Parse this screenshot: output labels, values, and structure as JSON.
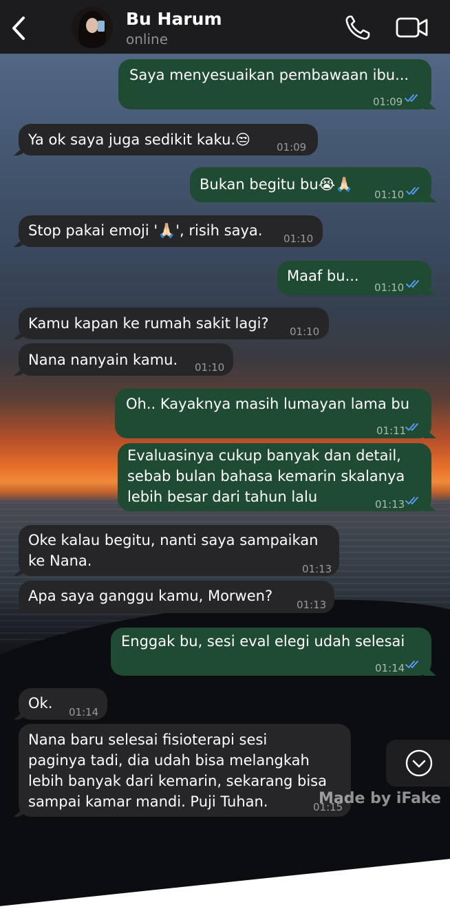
{
  "header": {
    "contact_name": "Bu Harum",
    "status": "online"
  },
  "messages": [
    {
      "dir": "out",
      "lines": [
        "Saya menyesuaikan pembawaan ibu..."
      ],
      "time": "01:09",
      "read": true
    },
    {
      "dir": "in",
      "lines": [
        "Ya ok saya juga sedikit kaku.😒"
      ],
      "time": "01:09"
    },
    {
      "dir": "out",
      "lines": [
        "Bukan begitu bu😭🙏🏻"
      ],
      "time": "01:10",
      "read": true
    },
    {
      "dir": "in",
      "lines": [
        "Stop pakai emoji '🙏🏻', risih saya."
      ],
      "time": "01:10"
    },
    {
      "dir": "out",
      "lines": [
        "Maaf bu..."
      ],
      "time": "01:10",
      "read": true
    },
    {
      "dir": "in",
      "lines": [
        "Kamu kapan ke rumah sakit lagi?"
      ],
      "time": "01:10"
    },
    {
      "dir": "in",
      "lines": [
        "Nana nanyain kamu."
      ],
      "time": "01:10"
    },
    {
      "dir": "out",
      "lines": [
        "Oh.. Kayaknya masih lumayan lama bu"
      ],
      "time": "01:11",
      "read": true
    },
    {
      "dir": "out",
      "lines": [
        "Evaluasinya cukup banyak dan detail,",
        "sebab bulan bahasa kemarin skalanya",
        "lebih besar dari tahun lalu"
      ],
      "time": "01:13",
      "read": true
    },
    {
      "dir": "in",
      "lines": [
        "Oke kalau begitu, nanti saya sampaikan",
        "ke Nana."
      ],
      "time": "01:13"
    },
    {
      "dir": "in",
      "lines": [
        "Apa saya ganggu kamu, Morwen?"
      ],
      "time": "01:13"
    },
    {
      "dir": "out",
      "lines": [
        "Enggak bu, sesi eval elegi udah selesai"
      ],
      "time": "01:14",
      "read": true
    },
    {
      "dir": "in",
      "lines": [
        "Ok."
      ],
      "time": "01:14"
    },
    {
      "dir": "in",
      "lines": [
        "Nana baru selesai fisioterapi sesi",
        "paginya tadi, dia udah bisa melangkah",
        "lebih banyak dari kemarin, sekarang bisa",
        "sampai kamar mandi. Puji Tuhan."
      ],
      "time": "01:15"
    }
  ],
  "watermark": "Made by iFake",
  "icons": {
    "back": "chevron-left-icon",
    "call": "phone-icon",
    "video": "video-camera-icon",
    "scroll": "chevron-down-circle-icon",
    "read_receipt": "double-check-icon"
  },
  "colors": {
    "header_bg": "#1c1c1e",
    "incoming_bubble": "#262628",
    "outgoing_bubble": "#1f4b32",
    "read_tick": "#5aa0ff"
  }
}
